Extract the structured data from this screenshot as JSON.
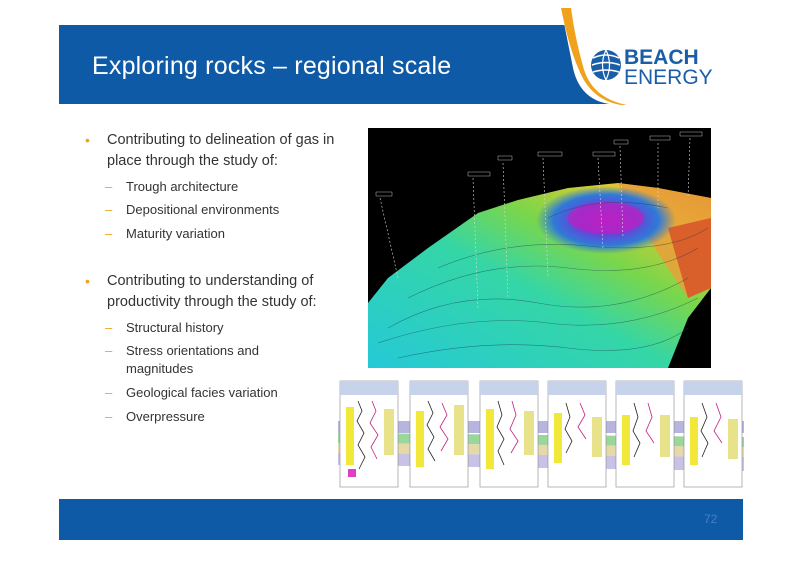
{
  "title": "Exploring rocks – regional scale",
  "logo": {
    "line1": "BEACH",
    "line2": "ENERGY"
  },
  "bullets": [
    {
      "text": "Contributing to delineation of gas in place through the study of:",
      "sub": [
        "Trough architecture",
        "Depositional environments",
        "Maturity variation"
      ]
    },
    {
      "text": "Contributing to understanding of productivity through the study of:",
      "sub": [
        "Structural history",
        "Stress orientations and magnitudes",
        "Geological facies variation",
        "Overpressure"
      ]
    }
  ],
  "page_number": "72",
  "colors": {
    "brand_blue": "#0e5aa7",
    "accent_orange": "#f0a21c"
  }
}
